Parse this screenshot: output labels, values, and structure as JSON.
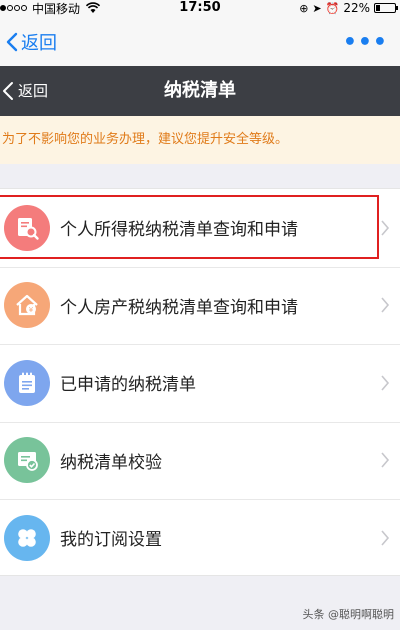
{
  "status_bar": {
    "carrier": "中国移动",
    "time": "17:50",
    "battery": "22%",
    "battery_level": 0.22
  },
  "outer_nav": {
    "back_label": "返回",
    "more_label": "•••"
  },
  "app_header": {
    "back_label": "返回",
    "title": "纳税清单"
  },
  "warning": {
    "text": "为了不影响您的业务办理，建议您提升安全等级。"
  },
  "menu": {
    "items": [
      {
        "label": "个人所得税纳税清单查询和申请",
        "icon": "tax-document-search-icon",
        "color": "#f47c7c",
        "highlighted": true
      },
      {
        "label": "个人房产税纳税清单查询和申请",
        "icon": "house-tax-icon",
        "color": "#f6a778"
      },
      {
        "label": "已申请的纳税清单",
        "icon": "notepad-icon",
        "color": "#7ea6ee"
      },
      {
        "label": "纳税清单校验",
        "icon": "verify-certificate-icon",
        "color": "#78c39a"
      },
      {
        "label": "我的订阅设置",
        "icon": "clover-icon",
        "color": "#67b6ef"
      }
    ]
  },
  "colors": {
    "link_blue": "#1a7ef0",
    "header_dark": "#3c3e44",
    "warning_text": "#e07b1a",
    "warning_bg": "#fdf4e3",
    "highlight_red": "#e02020"
  },
  "watermark": {
    "text": "头条 @聪明啊聪明"
  }
}
